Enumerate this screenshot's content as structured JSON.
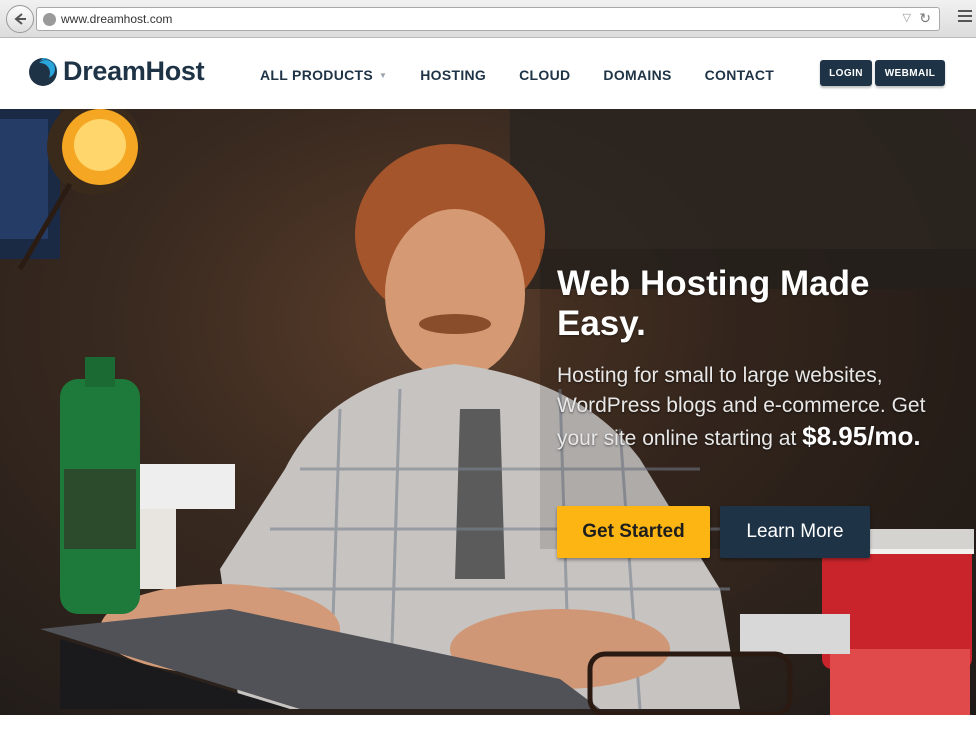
{
  "browser": {
    "url": "www.dreamhost.com",
    "back_icon": "back-arrow-icon",
    "reload_icon": "reload-icon"
  },
  "header": {
    "logo_text": "DreamHost",
    "nav": [
      {
        "label": "ALL PRODUCTS",
        "has_caret": true
      },
      {
        "label": "HOSTING"
      },
      {
        "label": "CLOUD"
      },
      {
        "label": "DOMAINS"
      },
      {
        "label": "CONTACT"
      }
    ],
    "login_label": "LOGIN",
    "webmail_label": "WEBMAIL"
  },
  "hero": {
    "title": "Web Hosting Made Easy.",
    "text": "Hosting for small to large websites, WordPress blogs and e-commerce. Get your site online starting at",
    "price": "$8.95/mo.",
    "get_started_label": "Get Started",
    "learn_more_label": "Learn More"
  },
  "colors": {
    "brand_navy": "#1e3346",
    "accent_yellow": "#fcb512"
  }
}
